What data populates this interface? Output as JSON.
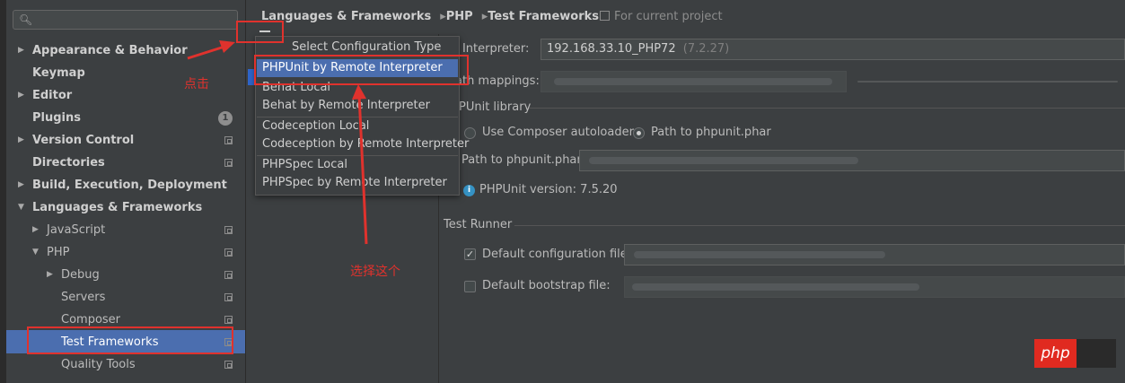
{
  "sidebar": {
    "search_placeholder": "",
    "items": [
      {
        "label": "Appearance & Behavior",
        "expanded": false
      },
      {
        "label": "Keymap"
      },
      {
        "label": "Editor",
        "expanded": false
      },
      {
        "label": "Plugins",
        "badge": "1"
      },
      {
        "label": "Version Control",
        "expanded": false
      },
      {
        "label": "Directories"
      },
      {
        "label": "Build, Execution, Deployment",
        "expanded": false
      },
      {
        "label": "Languages & Frameworks",
        "expanded": true
      },
      {
        "label": "JavaScript",
        "expanded": false
      },
      {
        "label": "PHP",
        "expanded": true
      },
      {
        "label": "Debug",
        "expanded": false
      },
      {
        "label": "Servers"
      },
      {
        "label": "Composer"
      },
      {
        "label": "Test Frameworks",
        "selected": true
      },
      {
        "label": "Quality Tools"
      }
    ]
  },
  "header": {
    "breadcrumb": [
      "Languages & Frameworks",
      "PHP",
      "Test Frameworks"
    ],
    "scope": "For current project"
  },
  "popup": {
    "title": "Select Configuration Type",
    "items": [
      {
        "label": "PHPUnit by Remote Interpreter",
        "selected": true
      },
      {
        "label": "Behat Local"
      },
      {
        "label": "Behat by Remote Interpreter"
      },
      {
        "label": "Codeception Local"
      },
      {
        "label": "Codeception by Remote Interpreter"
      },
      {
        "label": "PHPSpec Local"
      },
      {
        "label": "PHPSpec by Remote Interpreter"
      }
    ]
  },
  "config": {
    "interpreter_label": "I Interpreter:",
    "interpreter_value": "192.168.33.10_PHP72",
    "interpreter_version": "(7.2.27)",
    "path_mappings_label": "ath mappings:",
    "phpunit_library_label": "PUnit library",
    "use_composer_label": "Use Composer autoloader",
    "path_to_phar_label": "Path to phpunit.phar",
    "path_to_phar_field_label": "Path to phpunit.phar",
    "phpunit_version": "PHPUnit version: 7.5.20",
    "test_runner_label": "Test Runner",
    "default_config_label": "Default configuration file:",
    "default_bootstrap_label": "Default bootstrap file:"
  },
  "annotations": {
    "click_text": "点击",
    "select_text": "选择这个"
  },
  "logo": {
    "text": "php"
  },
  "colors": {
    "accent": "#4b6eaf",
    "annotation": "#e0322d",
    "background": "#3c3f41"
  }
}
